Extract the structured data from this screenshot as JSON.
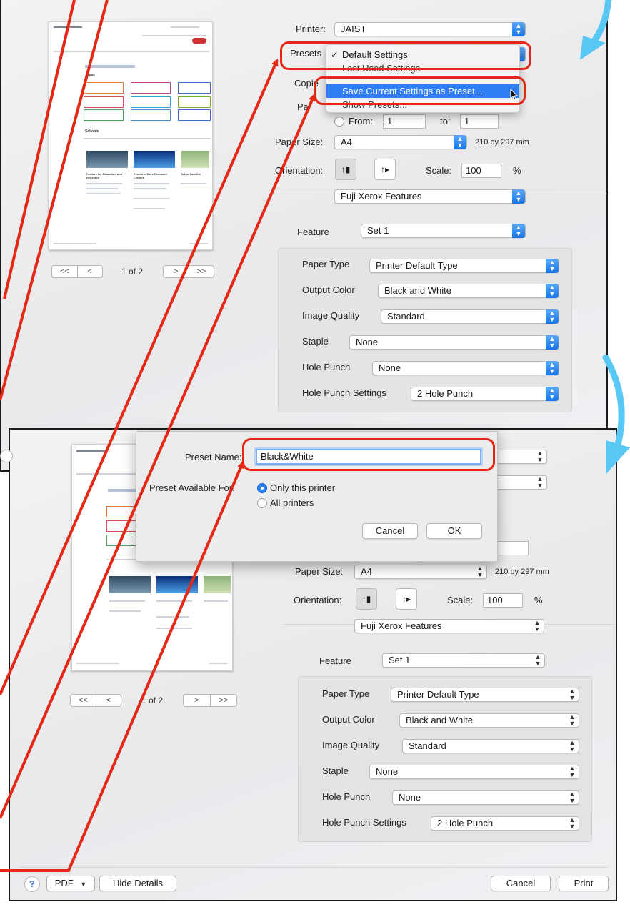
{
  "top": {
    "printer_label": "Printer:",
    "printer_value": "JAIST",
    "presets_label": "Presets",
    "copies_label": "Copie",
    "pages_label": "Pa",
    "from_label": "From:",
    "from_value": "1",
    "to_label": "to:",
    "to_value": "1",
    "paper_size_label": "Paper Size:",
    "paper_size_value": "A4",
    "paper_size_dims": "210 by 297 mm",
    "orientation_label": "Orientation:",
    "scale_label": "Scale:",
    "scale_value": "100",
    "percent": "%",
    "section_value": "Fuji Xerox Features",
    "feature_label": "Feature",
    "feature_value": "Set 1",
    "page_indicator": "1 of 2",
    "presets_menu": {
      "item1": "Default Settings",
      "item1_check": "✓",
      "item2": "Last Used Settings",
      "item3": "Save Current Settings as Preset...",
      "item4": "Show Presets..."
    }
  },
  "features": [
    {
      "label": "Paper Type",
      "value": "Printer Default Type"
    },
    {
      "label": "Output Color",
      "value": "Black and White"
    },
    {
      "label": "Image Quality",
      "value": "Standard"
    },
    {
      "label": "Staple",
      "value": "None"
    },
    {
      "label": "Hole Punch",
      "value": "None"
    },
    {
      "label": "Hole Punch Settings",
      "value": "2 Hole Punch"
    }
  ],
  "bottom": {
    "paper_size_label": "Paper Size:",
    "paper_size_value": "A4",
    "paper_size_dims": "210 by 297 mm",
    "orientation_label": "Orientation:",
    "scale_label": "Scale:",
    "scale_value": "100",
    "percent": "%",
    "section_value": "Fuji Xerox Features",
    "feature_label": "Feature",
    "feature_value": "Set 1",
    "page_indicator": "1 of 2",
    "help": "?",
    "pdf_label": "PDF",
    "hide_details": "Hide Details",
    "cancel": "Cancel",
    "print": "Print",
    "sheet": {
      "preset_name_label": "Preset Name:",
      "preset_name_value": "Black&White",
      "available_label": "Preset Available For:",
      "option_only": "Only this printer",
      "option_all": "All printers",
      "cancel": "Cancel",
      "ok": "OK"
    }
  },
  "preview_text": {
    "areas": "Areas",
    "schools": "Schools",
    "col1": "Centers for Education and Research",
    "col2": "Excellent Core Research Centers",
    "col3": "Tokyo Satellite"
  },
  "colors": {
    "annotation": "#e52815",
    "arrow": "#5ac8f5",
    "accent": "#2f7ef3"
  }
}
